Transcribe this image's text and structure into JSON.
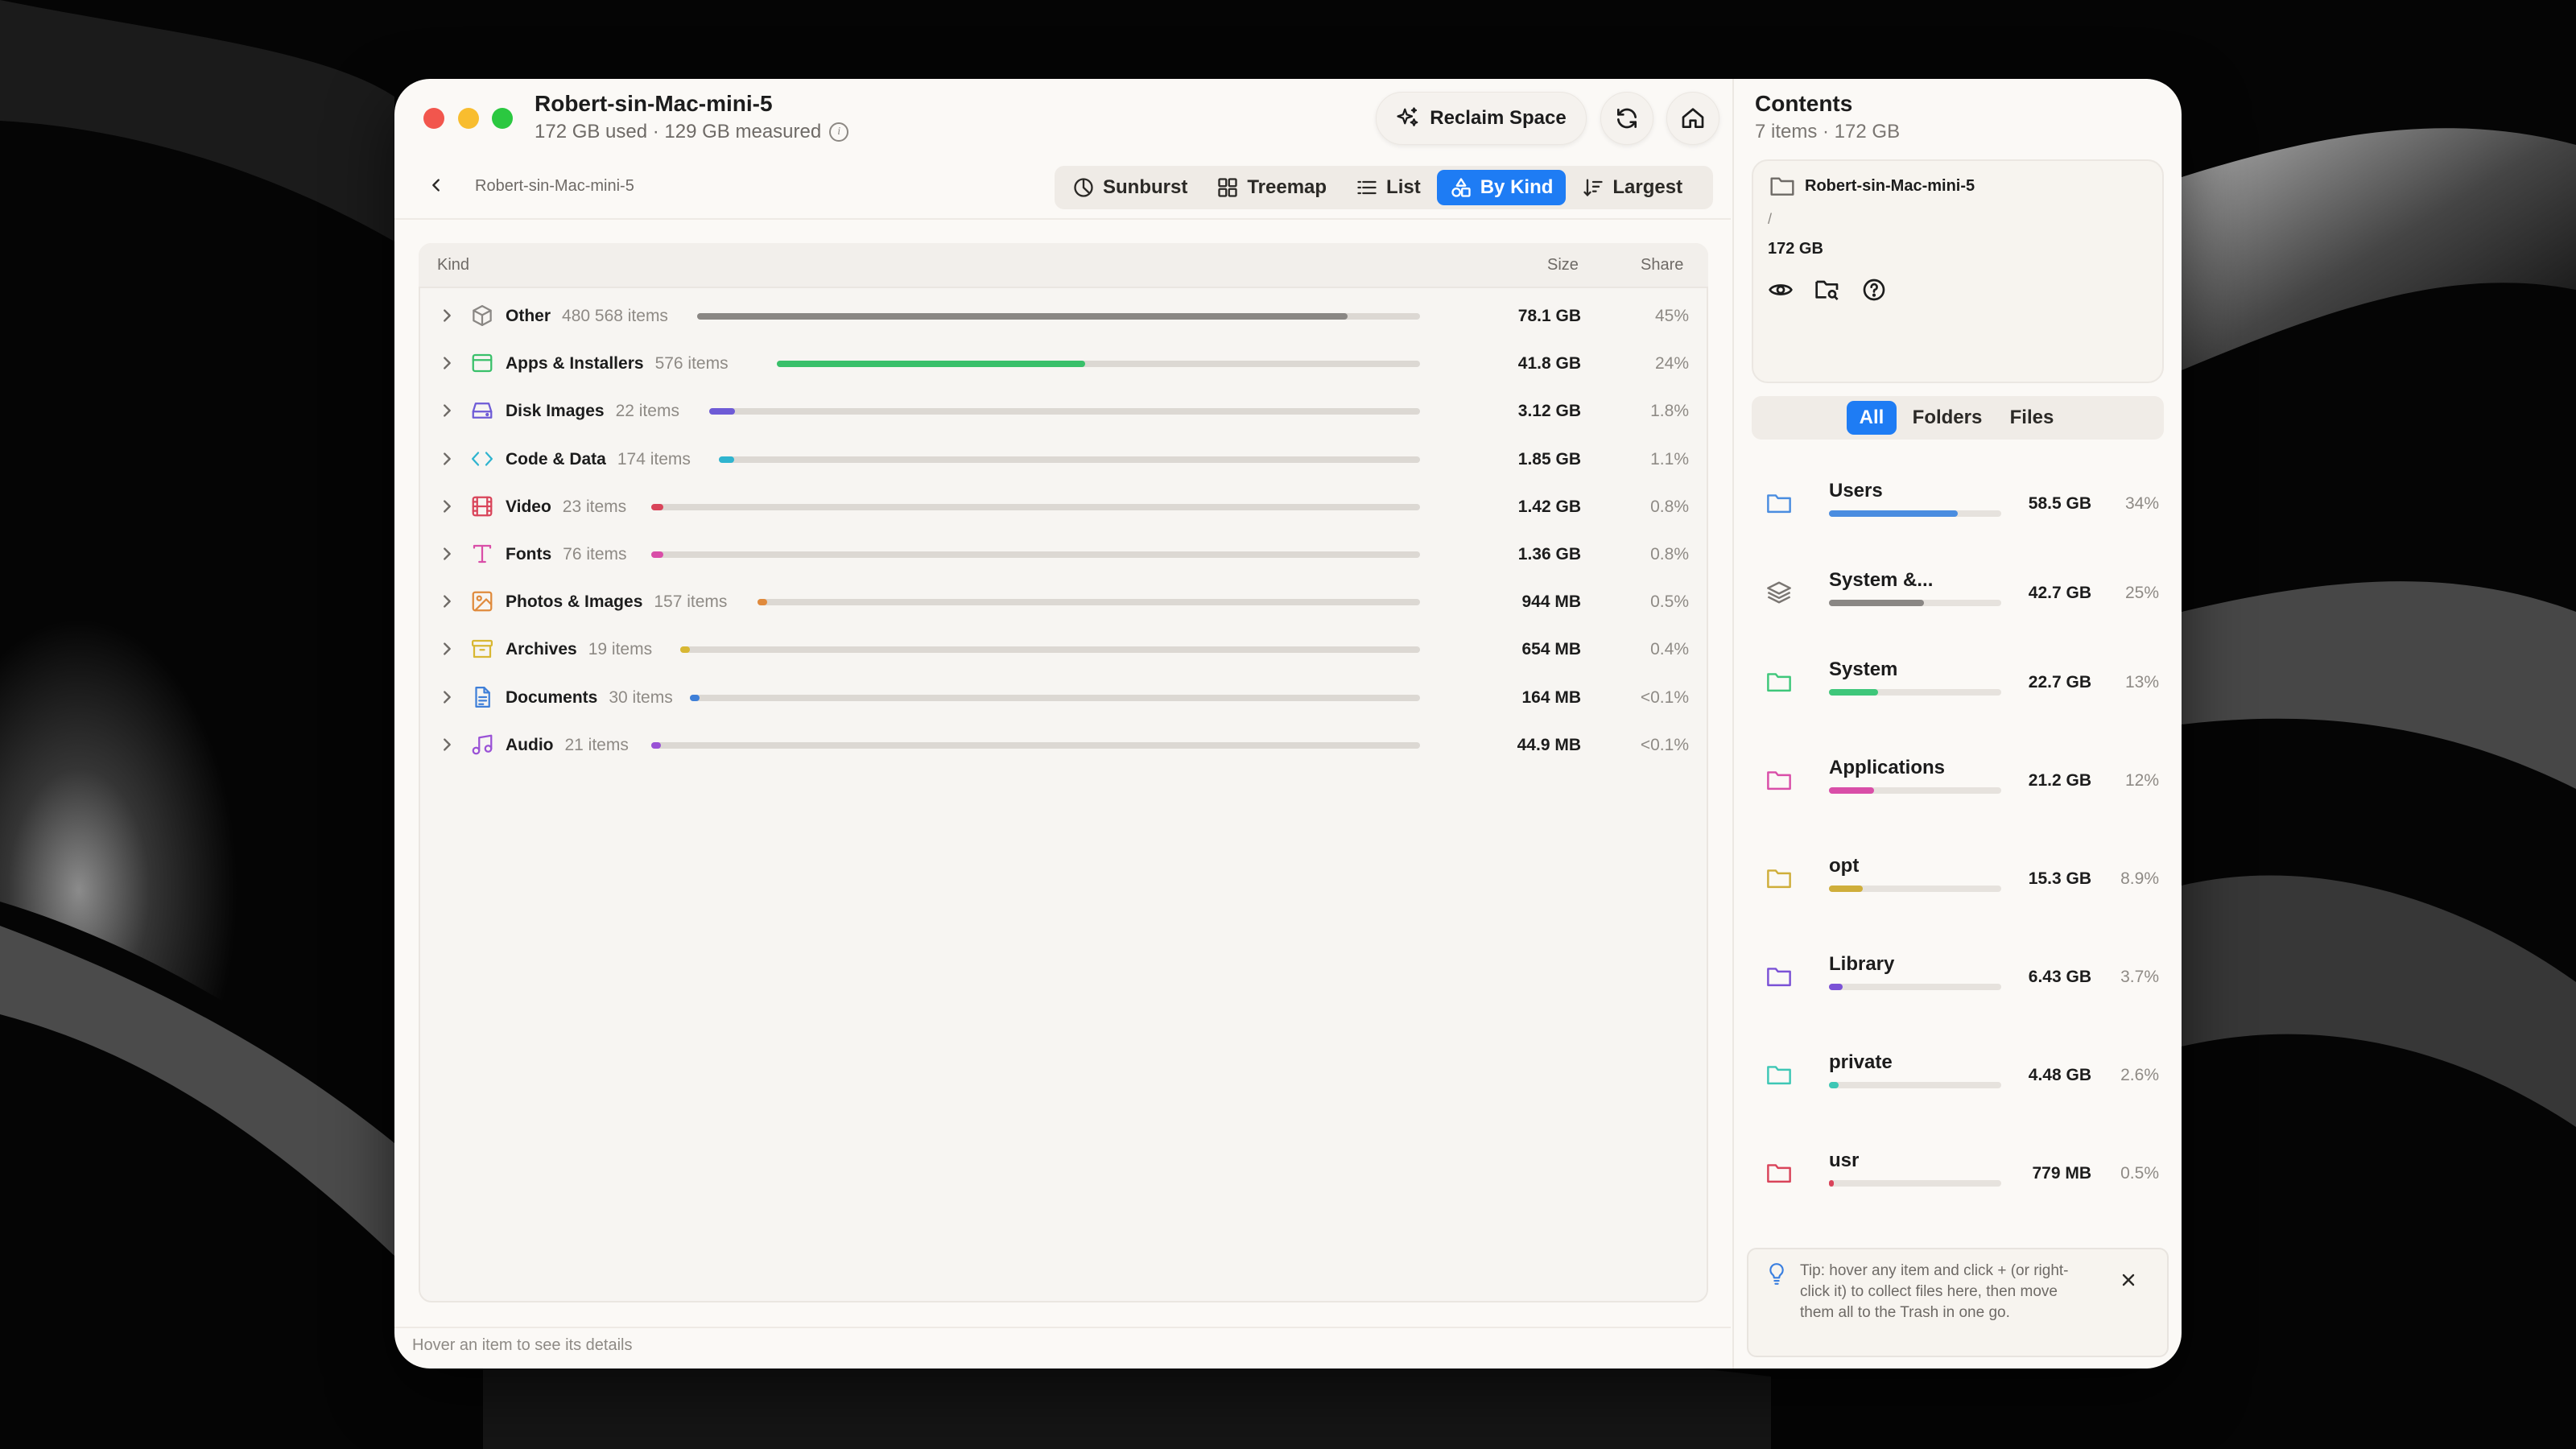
{
  "window": {
    "title": "Robert-sin-Mac-mini-5",
    "subtitle": "172 GB used · 129 GB measured"
  },
  "toolbar": {
    "reclaim_label": "Reclaim Space"
  },
  "breadcrumb": "Robert-sin-Mac-mini-5",
  "views": [
    {
      "label": "Sunburst",
      "icon": "sunburst-icon",
      "active": false
    },
    {
      "label": "Treemap",
      "icon": "treemap-icon",
      "active": false
    },
    {
      "label": "List",
      "icon": "list-icon",
      "active": false
    },
    {
      "label": "By Kind",
      "icon": "shapes-icon",
      "active": true
    },
    {
      "label": "Largest",
      "icon": "sort-icon",
      "active": false
    }
  ],
  "table": {
    "headers": {
      "kind": "Kind",
      "size": "Size",
      "share": "Share"
    },
    "rows": [
      {
        "name": "Other",
        "count": "480 568 items",
        "size": "78.1 GB",
        "share": "45%",
        "fraction": 0.45,
        "color": "#8a8784",
        "icon": "box-icon"
      },
      {
        "name": "Apps & Installers",
        "count": "576 items",
        "size": "41.8 GB",
        "share": "24%",
        "fraction": 0.24,
        "color": "#39c06a",
        "icon": "app-window-icon"
      },
      {
        "name": "Disk Images",
        "count": "22 items",
        "size": "3.12 GB",
        "share": "1.8%",
        "fraction": 0.018,
        "color": "#6e5bd6",
        "icon": "disk-icon"
      },
      {
        "name": "Code & Data",
        "count": "174 items",
        "size": "1.85 GB",
        "share": "1.1%",
        "fraction": 0.011,
        "color": "#2fb4cf",
        "icon": "code-icon"
      },
      {
        "name": "Video",
        "count": "23 items",
        "size": "1.42 GB",
        "share": "0.8%",
        "fraction": 0.008,
        "color": "#d9445a",
        "icon": "film-icon"
      },
      {
        "name": "Fonts",
        "count": "76 items",
        "size": "1.36 GB",
        "share": "0.8%",
        "fraction": 0.008,
        "color": "#d94ea8",
        "icon": "type-icon"
      },
      {
        "name": "Photos & Images",
        "count": "157 items",
        "size": "944 MB",
        "share": "0.5%",
        "fraction": 0.005,
        "color": "#e08a3c",
        "icon": "image-icon"
      },
      {
        "name": "Archives",
        "count": "19 items",
        "size": "654 MB",
        "share": "0.4%",
        "fraction": 0.004,
        "color": "#d8b733",
        "icon": "archive-icon"
      },
      {
        "name": "Documents",
        "count": "30 items",
        "size": "164 MB",
        "share": "<0.1%",
        "fraction": 0.001,
        "color": "#3f7fd8",
        "icon": "document-icon"
      },
      {
        "name": "Audio",
        "count": "21 items",
        "size": "44.9 MB",
        "share": "<0.1%",
        "fraction": 0.001,
        "color": "#9a52d6",
        "icon": "music-icon"
      }
    ]
  },
  "status_text": "Hover an item to see its details",
  "sidebar": {
    "title": "Contents",
    "subtitle": "7 items · 172 GB",
    "selected": {
      "name": "Robert-sin-Mac-mini-5",
      "path": "/",
      "size": "172 GB"
    },
    "filters": [
      {
        "label": "All",
        "active": true
      },
      {
        "label": "Folders",
        "active": false
      },
      {
        "label": "Files",
        "active": false
      }
    ],
    "items": [
      {
        "name": "Users",
        "size": "58.5 GB",
        "share": "34%",
        "fraction": 0.34,
        "color": "#4a8de0",
        "icon": "folder-icon"
      },
      {
        "name": "System &...",
        "size": "42.7 GB",
        "share": "25%",
        "fraction": 0.25,
        "color": "#8a8784",
        "icon": "layers-icon"
      },
      {
        "name": "System",
        "size": "22.7 GB",
        "share": "13%",
        "fraction": 0.13,
        "color": "#3ec77a",
        "icon": "folder-icon"
      },
      {
        "name": "Applications",
        "size": "21.2 GB",
        "share": "12%",
        "fraction": 0.12,
        "color": "#d94ea8",
        "icon": "folder-icon"
      },
      {
        "name": "opt",
        "size": "15.3 GB",
        "share": "8.9%",
        "fraction": 0.089,
        "color": "#cfae3a",
        "icon": "folder-icon"
      },
      {
        "name": "Library",
        "size": "6.43 GB",
        "share": "3.7%",
        "fraction": 0.037,
        "color": "#7b52d6",
        "icon": "folder-icon"
      },
      {
        "name": "private",
        "size": "4.48 GB",
        "share": "2.6%",
        "fraction": 0.026,
        "color": "#3ec7b5",
        "icon": "folder-icon"
      },
      {
        "name": "usr",
        "size": "779 MB",
        "share": "0.5%",
        "fraction": 0.005,
        "color": "#d9445a",
        "icon": "folder-icon"
      }
    ],
    "tip": "Tip: hover any item and click + (or right-click it) to collect files here, then move them all to the Trash in one go."
  }
}
